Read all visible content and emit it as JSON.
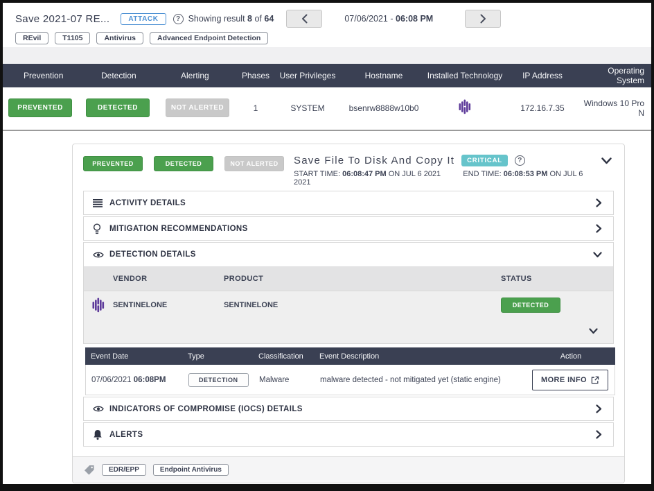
{
  "colors": {
    "navy_header": "#3a4053",
    "green_badge": "#4ba04e",
    "gray_badge": "#c9c9c9",
    "teal_critical": "#66c4cb",
    "blue_attack": "#4a8fd3",
    "sentinelone_purple": "#5d3a9a"
  },
  "icons": {
    "help_glyph": "?"
  },
  "top_bar": {
    "title": "Save 2021-07 RE...",
    "attack_badge": "ATTACK",
    "showing_prefix": "Showing result",
    "result_current": "8",
    "result_of": "of",
    "result_total": "64",
    "date_prefix": "07/06/2021 -",
    "time": "06:08 PM",
    "tags": [
      "REvil",
      "T1105",
      "Antivirus",
      "Advanced Endpoint Detection"
    ]
  },
  "main_table": {
    "columns": [
      "Prevention",
      "Detection",
      "Alerting",
      "Phases",
      "User Privileges",
      "Hostname",
      "Installed Technology",
      "IP Address",
      "Operating System"
    ],
    "row": {
      "prevention": "PREVENTED",
      "detection": "DETECTED",
      "alerting": "NOT ALERTED",
      "phases": "1",
      "user_privileges": "SYSTEM",
      "hostname": "bsenrw8888w10b0",
      "installed_technology": "sentinelone-icon",
      "ip_address": "172.16.7.35",
      "operating_system": "Windows 10 Pro N"
    }
  },
  "detail_card": {
    "badges": {
      "prevention": "PREVENTED",
      "detection": "DETECTED",
      "alerting": "NOT ALERTED"
    },
    "title": "Save File To Disk And Copy It",
    "severity": "CRITICAL",
    "start_time_label": "START TIME:",
    "start_time": "06:08:47 PM",
    "start_time_suffix": "ON JUL 6 2021",
    "end_time_label": "END TIME:",
    "end_time": "06:08:53 PM",
    "end_time_suffix": "ON JUL 6 2021",
    "sections": {
      "activity": "ACTIVITY DETAILS",
      "mitigation": "MITIGATION RECOMMENDATIONS",
      "detection": "DETECTION DETAILS",
      "iocs": "INDICATORS OF COMPROMISE (IOCS) DETAILS",
      "alerts": "ALERTS"
    },
    "vendor_table": {
      "columns": [
        "VENDOR",
        "PRODUCT",
        "STATUS"
      ],
      "row": {
        "vendor": "SENTINELONE",
        "product": "SENTINELONE",
        "status": "DETECTED"
      }
    },
    "event_table": {
      "columns": [
        "Event Date",
        "Type",
        "Classification",
        "Event Description",
        "Action"
      ],
      "row": {
        "date": "07/06/2021",
        "time": "06:08PM",
        "type": "DETECTION",
        "classification": "Malware",
        "description": "malware detected - not mitigated yet (static engine)",
        "action": "MORE INFO"
      }
    },
    "footer_tags": [
      "EDR/EPP",
      "Endpoint Antivirus"
    ]
  }
}
